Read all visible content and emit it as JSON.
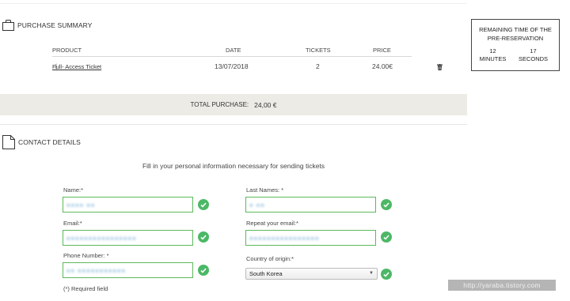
{
  "purchase": {
    "heading": "PURCHASE SUMMARY",
    "columns": [
      "PRODUCT",
      "DATE",
      "TICKETS",
      "PRICE"
    ],
    "row": {
      "product": "Full- Access Ticket",
      "date": "13/07/2018",
      "tickets": "2",
      "price": "24.00€"
    },
    "total_label": "TOTAL PURCHASE:",
    "total_amount": "24,00 €"
  },
  "timer": {
    "title": "REMAINING TIME OF THE PRE-RESERVATION",
    "minutes_value": "12",
    "minutes_label": "MINUTES",
    "seconds_value": "17",
    "seconds_label": "SECONDS"
  },
  "contact": {
    "heading": "CONTACT DETAILS",
    "intro": "Fill in your personal information necessary for sending tickets",
    "fields": {
      "name": {
        "label": "Name:*",
        "value": "●●●● ●●"
      },
      "last_names": {
        "label": "Last Names: *",
        "value": "● ●●"
      },
      "email": {
        "label": "Email:*",
        "value": "●●●●●●●●●●●●●●●●"
      },
      "repeat_email": {
        "label": "Repeat your email:*",
        "value": "●●●●●●●●●●●●●●●●"
      },
      "phone": {
        "label": "Phone Number: *",
        "value": "●● ●●●●●●●●●●●"
      },
      "country": {
        "label": "Country of origin:*",
        "value": "South Korea"
      }
    },
    "required_note": "(*) Required field"
  },
  "watermark": "http://yaraba.tistory.com",
  "icons": {
    "bag": "shopping-bag-icon",
    "doc": "document-icon",
    "trash": "trash-icon",
    "check": "check-icon",
    "chevron": "chevron-down-icon"
  },
  "colors": {
    "valid": "#4cb866",
    "total_bg": "#ecebe6",
    "field_border": "#5cb85c"
  }
}
